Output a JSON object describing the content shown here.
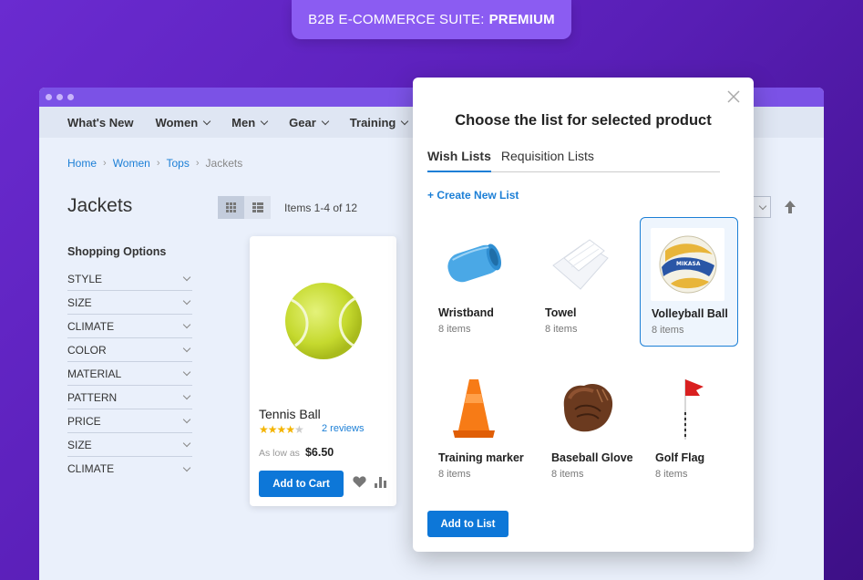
{
  "promo": {
    "text": "B2B E-COMMERCE SUITE:",
    "bold": "PREMIUM"
  },
  "nav": {
    "items": [
      "What's New",
      "Women",
      "Men",
      "Gear",
      "Training"
    ]
  },
  "breadcrumb": {
    "items": [
      "Home",
      "Women",
      "Tops"
    ],
    "current": "Jackets"
  },
  "page": {
    "title": "Jackets",
    "items_count": "Items 1-4 of 12"
  },
  "filters": {
    "title": "Shopping Options",
    "items": [
      "STYLE",
      "SIZE",
      "CLIMATE",
      "COLOR",
      "MATERIAL",
      "PATTERN",
      "PRICE",
      "SIZE",
      "CLIMATE"
    ]
  },
  "product": {
    "name": "Tennis Ball",
    "rating": 4,
    "rating_max": 5,
    "reviews": "2 reviews",
    "as_low_as": "As low as",
    "price": "$6.50",
    "add_to_cart": "Add to Cart"
  },
  "modal": {
    "title": "Choose the list for selected product",
    "tabs": [
      "Wish Lists",
      "Requisition Lists"
    ],
    "create_link": "+ Create New List",
    "lists": [
      {
        "name": "Wristband",
        "count": "8 items",
        "icon": "wristband-image"
      },
      {
        "name": "Towel",
        "count": "8 items",
        "icon": "towel-image"
      },
      {
        "name": "Volleyball Ball",
        "count": "8 items",
        "icon": "volleyball-image",
        "selected": true
      },
      {
        "name": "Training marker",
        "count": "8 items",
        "icon": "cone-image"
      },
      {
        "name": "Baseball Glove",
        "count": "8 items",
        "icon": "glove-image"
      },
      {
        "name": "Golf Flag",
        "count": "8 items",
        "icon": "flag-image"
      }
    ],
    "add_to_list": "Add to List"
  },
  "colors": {
    "accent": "#0d77d8",
    "brand_purple": "#7b52e6",
    "link": "#1c7fd6",
    "star": "#f4b400"
  }
}
